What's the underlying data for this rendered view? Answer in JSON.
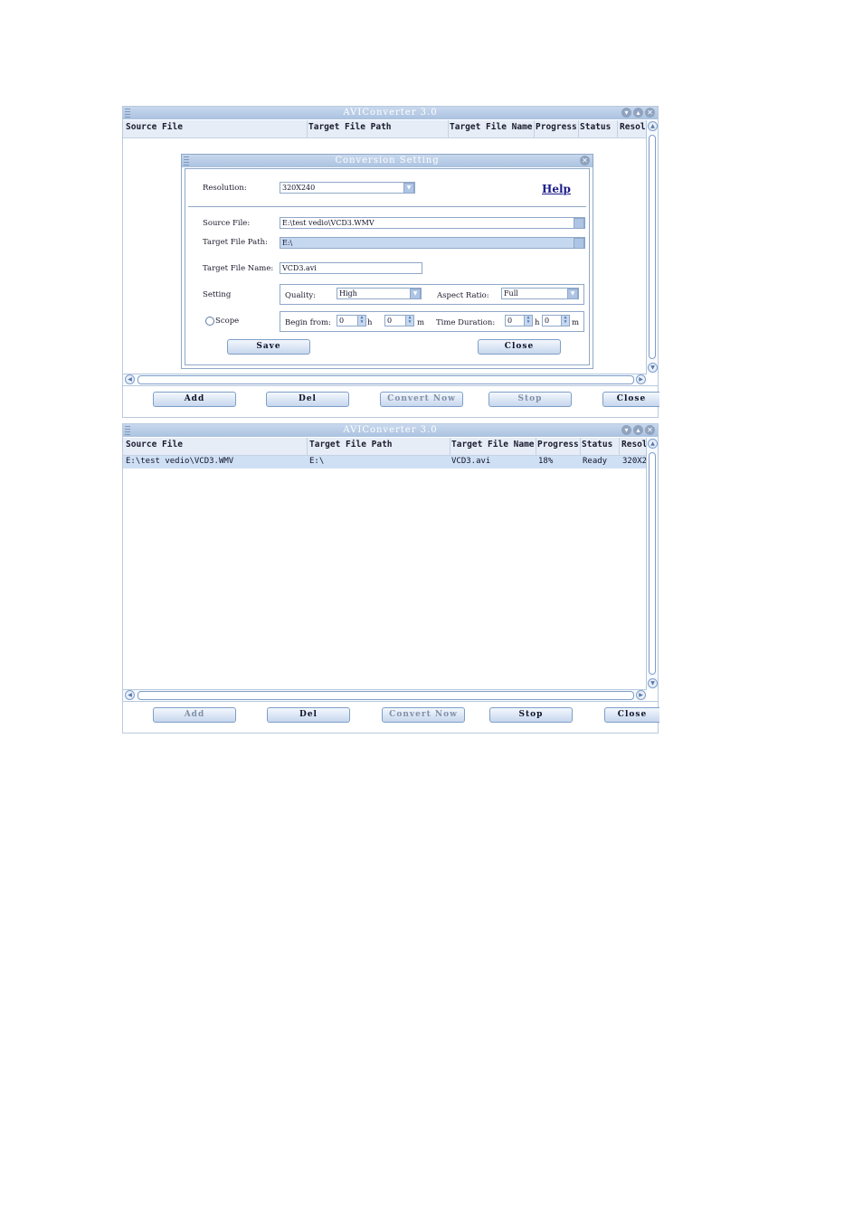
{
  "app": {
    "title": "AVIConverter 3.0"
  },
  "window_icons": {
    "minimize": "chevron-down-icon",
    "maximize": "triangle-up-icon",
    "close": "close-icon"
  },
  "table": {
    "columns": [
      "Source File",
      "Target File Path",
      "Target File Name",
      "Progress",
      "Status",
      "Resol"
    ]
  },
  "toolbar": {
    "add": "Add",
    "del": "Del",
    "convert_now": "Convert Now",
    "stop": "Stop",
    "close": "Close"
  },
  "dialog": {
    "title": "Conversion Setting",
    "resolution_label": "Resolution:",
    "resolution_value": "320X240",
    "help_label": "Help",
    "source_file_label": "Source File:",
    "source_file_value": "E:\\test vedio\\VCD3.WMV",
    "target_path_label": "Target File Path:",
    "target_path_value": "E:\\",
    "target_name_label": "Target File Name:",
    "target_name_value": "VCD3.avi",
    "setting_label": "Setting",
    "quality_label": "Quality:",
    "quality_value": "High",
    "aspect_label": "Aspect Ratio:",
    "aspect_value": "Full",
    "scope_label": "Scope",
    "begin_label": "Begin from:",
    "begin_h": "0",
    "h_unit": "h",
    "begin_m": "0",
    "m_unit": "m",
    "duration_label": "Time Duration:",
    "dur_h": "0",
    "dur_m": "0",
    "save": "Save",
    "close": "Close"
  },
  "list_row": {
    "source": "E:\\test vedio\\VCD3.WMV",
    "path": "E:\\",
    "name": "VCD3.avi",
    "progress": "18%",
    "status": "Ready",
    "resolution": "320X2"
  }
}
